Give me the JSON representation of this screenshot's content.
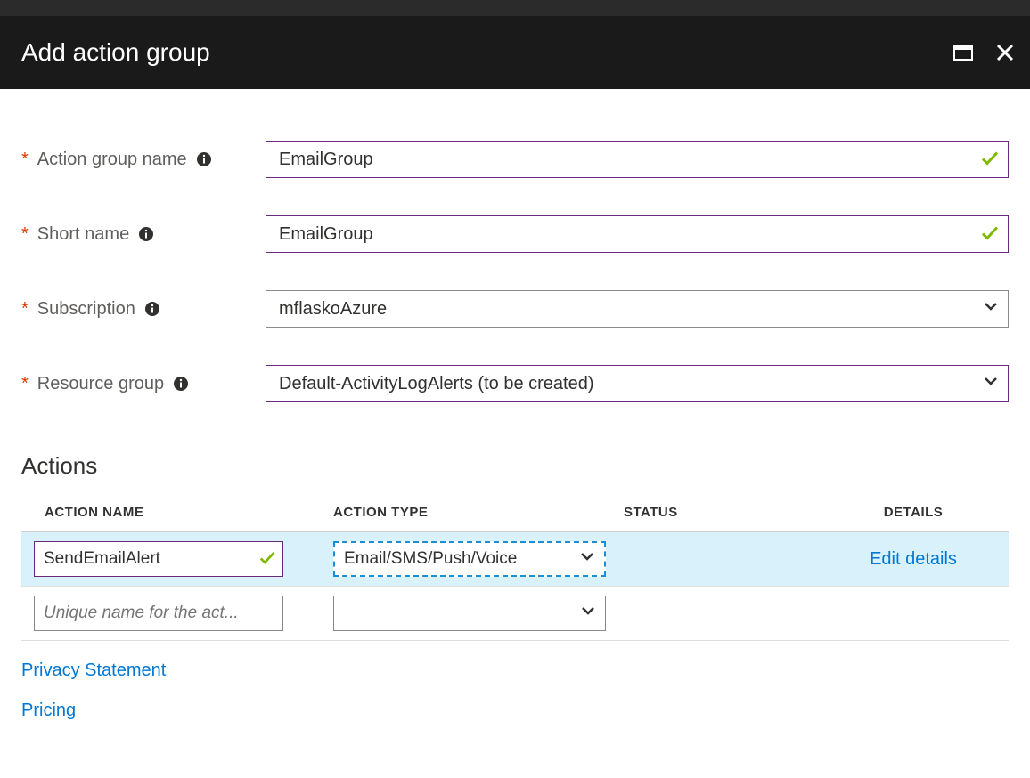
{
  "header": {
    "title": "Add action group"
  },
  "form": {
    "actionGroupName": {
      "label": "Action group name",
      "value": "EmailGroup"
    },
    "shortName": {
      "label": "Short name",
      "value": "EmailGroup"
    },
    "subscription": {
      "label": "Subscription",
      "value": "mflaskoAzure"
    },
    "resourceGroup": {
      "label": "Resource group",
      "value": "Default-ActivityLogAlerts (to be created)"
    }
  },
  "actions": {
    "title": "Actions",
    "headers": {
      "name": "ACTION NAME",
      "type": "ACTION TYPE",
      "status": "STATUS",
      "details": "DETAILS"
    },
    "rows": [
      {
        "name": "SendEmailAlert",
        "type": "Email/SMS/Push/Voice",
        "status": "",
        "detailsLink": "Edit details"
      }
    ],
    "newRow": {
      "namePlaceholder": "Unique name for the act...",
      "type": ""
    }
  },
  "footerLinks": {
    "privacy": "Privacy Statement",
    "pricing": "Pricing"
  }
}
